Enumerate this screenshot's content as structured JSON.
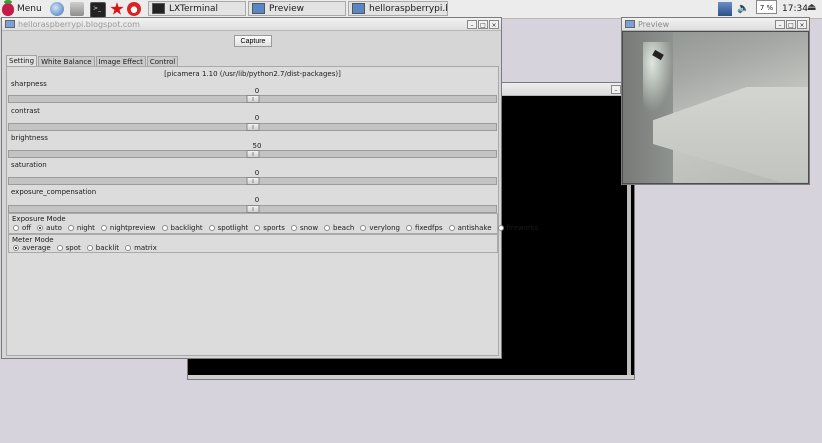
{
  "taskbar": {
    "menu_label": "Menu",
    "launchers": [
      "browser-icon",
      "file-manager-icon",
      "terminal-icon",
      "mathematica-icon",
      "wolfram-icon"
    ],
    "tasks": [
      {
        "label": "LXTerminal",
        "icon": "terminal-icon"
      },
      {
        "label": "Preview",
        "icon": "window-icon"
      },
      {
        "label": "helloraspberrypi.blog...",
        "icon": "window-icon"
      }
    ],
    "cpu_usage": "7 %",
    "clock": "17:34"
  },
  "terminal_window": {
    "title": ""
  },
  "preview_window": {
    "title": "Preview"
  },
  "app_window": {
    "title": "helloraspberrypi.blogspot.com",
    "capture_label": "Capture",
    "tabs": [
      {
        "label": "Setting",
        "active": true
      },
      {
        "label": "White Balance",
        "active": false
      },
      {
        "label": "Image Effect",
        "active": false
      },
      {
        "label": "Control",
        "active": false
      }
    ],
    "version_text": "[picamera 1.10 (/usr/lib/python2.7/dist-packages)]",
    "sliders": [
      {
        "label": "sharpness",
        "value": "0",
        "position": 0.5
      },
      {
        "label": "contrast",
        "value": "0",
        "position": 0.5
      },
      {
        "label": "brightness",
        "value": "50",
        "position": 0.5
      },
      {
        "label": "saturation",
        "value": "0",
        "position": 0.5
      },
      {
        "label": "exposure_compensation",
        "value": "0",
        "position": 0.5
      }
    ],
    "exposure_mode": {
      "title": "Exposure Mode",
      "selected": "auto",
      "options": [
        "off",
        "auto",
        "night",
        "nightpreview",
        "backlight",
        "spotlight",
        "sports",
        "snow",
        "beach",
        "verylong",
        "fixedfps",
        "antishake",
        "fireworks"
      ]
    },
    "meter_mode": {
      "title": "Meter Mode",
      "selected": "average",
      "options": [
        "average",
        "spot",
        "backlit",
        "matrix"
      ]
    }
  }
}
